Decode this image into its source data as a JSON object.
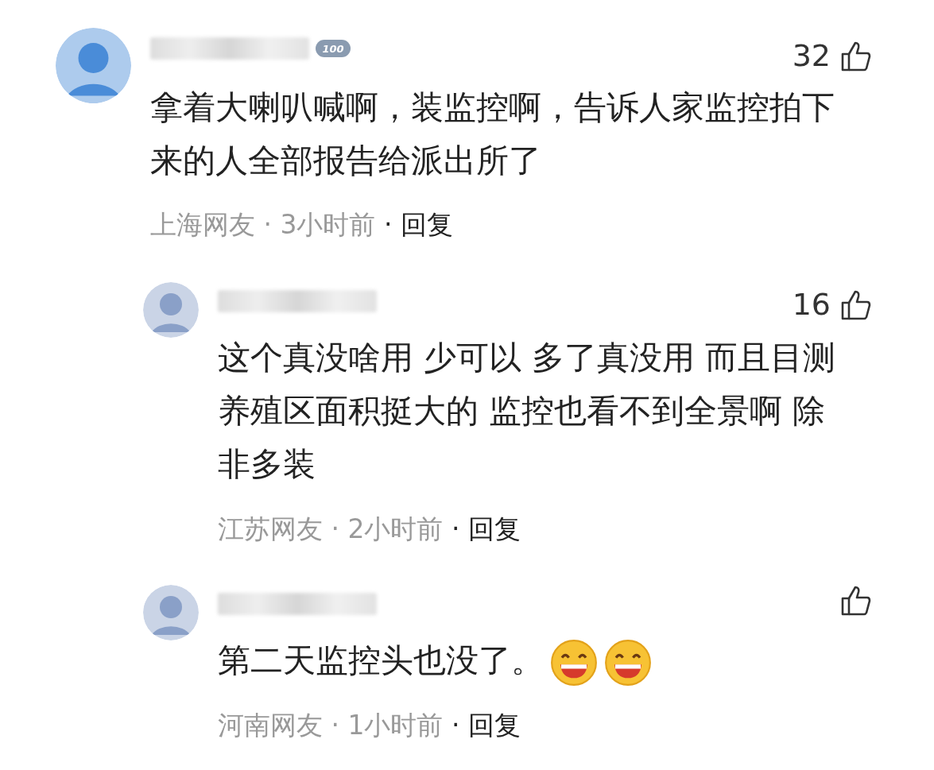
{
  "comments": [
    {
      "kind": "top",
      "badge": "100",
      "likes": "32",
      "text": "拿着大喇叭喊啊，装监控啊，告诉人家监控拍下来的人全部报告给派出所了",
      "region": "上海网友",
      "sep1": "·",
      "time": "3小时前",
      "sep2": "·",
      "reply": "回复"
    },
    {
      "kind": "reply",
      "likes": "16",
      "text": "这个真没啥用 少可以 多了真没用 而且目测养殖区面积挺大的 监控也看不到全景啊 除非多装",
      "region": "江苏网友",
      "sep1": "·",
      "time": "2小时前",
      "sep2": "·",
      "reply": "回复"
    },
    {
      "kind": "reply",
      "text": "第二天监控头也没了。",
      "region": "河南网友",
      "sep1": "·",
      "time": "1小时前",
      "sep2": "·",
      "reply": "回复",
      "emojis": [
        {
          "kind": "grinning"
        },
        {
          "kind": "grinning"
        }
      ]
    }
  ]
}
